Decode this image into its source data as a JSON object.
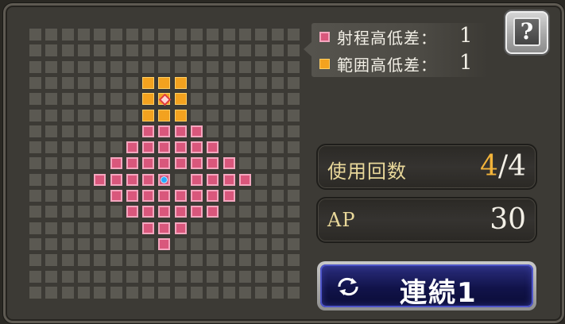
{
  "grid": {
    "cols": 17,
    "rows": 17,
    "range_cells": [
      [
        7,
        6
      ],
      [
        8,
        6
      ],
      [
        9,
        6
      ],
      [
        10,
        6
      ],
      [
        6,
        7
      ],
      [
        7,
        7
      ],
      [
        8,
        7
      ],
      [
        9,
        7
      ],
      [
        10,
        7
      ],
      [
        11,
        7
      ],
      [
        5,
        8
      ],
      [
        6,
        8
      ],
      [
        7,
        8
      ],
      [
        8,
        8
      ],
      [
        9,
        8
      ],
      [
        10,
        8
      ],
      [
        11,
        8
      ],
      [
        12,
        8
      ],
      [
        4,
        9
      ],
      [
        5,
        9
      ],
      [
        6,
        9
      ],
      [
        7,
        9
      ],
      [
        8,
        9
      ],
      [
        10,
        9
      ],
      [
        11,
        9
      ],
      [
        12,
        9
      ],
      [
        13,
        9
      ],
      [
        5,
        10
      ],
      [
        6,
        10
      ],
      [
        7,
        10
      ],
      [
        8,
        10
      ],
      [
        9,
        10
      ],
      [
        10,
        10
      ],
      [
        11,
        10
      ],
      [
        12,
        10
      ],
      [
        6,
        11
      ],
      [
        7,
        11
      ],
      [
        8,
        11
      ],
      [
        9,
        11
      ],
      [
        10,
        11
      ],
      [
        11,
        11
      ],
      [
        7,
        12
      ],
      [
        8,
        12
      ],
      [
        9,
        12
      ],
      [
        8,
        13
      ]
    ],
    "area_cells": [
      [
        7,
        3
      ],
      [
        8,
        3
      ],
      [
        9,
        3
      ],
      [
        7,
        4
      ],
      [
        8,
        4
      ],
      [
        9,
        4
      ],
      [
        7,
        5
      ],
      [
        8,
        5
      ],
      [
        9,
        5
      ]
    ],
    "center_cell": [
      8,
      9
    ],
    "target_cell": [
      8,
      4
    ]
  },
  "legend": {
    "range_height_label": "射程高低差：",
    "range_height_value": "1",
    "area_height_label": "範囲高低差：",
    "area_height_value": "1",
    "range_color": "#d9577c",
    "area_color": "#f3a21f"
  },
  "help": {
    "glyph": "?"
  },
  "uses": {
    "label": "使用回数",
    "current": "4",
    "sep": "/",
    "max": "4"
  },
  "ap": {
    "label": "AP",
    "value": "30"
  },
  "chain_button": {
    "label": "連続1",
    "icon": "rotate-arrows-icon"
  }
}
